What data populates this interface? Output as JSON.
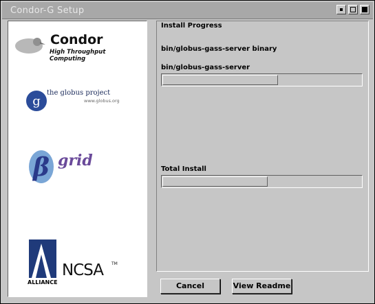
{
  "window": {
    "title": "Condor-G Setup"
  },
  "logos": {
    "condor": {
      "name": "Condor",
      "tagline": "High Throughput Computing"
    },
    "globus": {
      "name": "the globus project",
      "url": "www.globus.org",
      "letter": "g"
    },
    "bgrid": {
      "greek": "β",
      "text": "grid"
    },
    "alliance": {
      "text": "ALLIANCE"
    },
    "ncsa": {
      "text": "NCSA",
      "tm": "TM"
    }
  },
  "install": {
    "group_title": "Install Progress",
    "current_file_heading": "bin/globus-gass-server binary",
    "current_file_label": "bin/globus-gass-server",
    "file_progress": 0.58,
    "total_label": "Total Install",
    "total_progress": 0.5
  },
  "buttons": {
    "cancel": "Cancel",
    "readme": "View Readme"
  },
  "colors": {
    "window_bg": "#c6c6c6",
    "titlebar_bg": "#a8a8a8",
    "panel_bg": "#ffffff"
  }
}
